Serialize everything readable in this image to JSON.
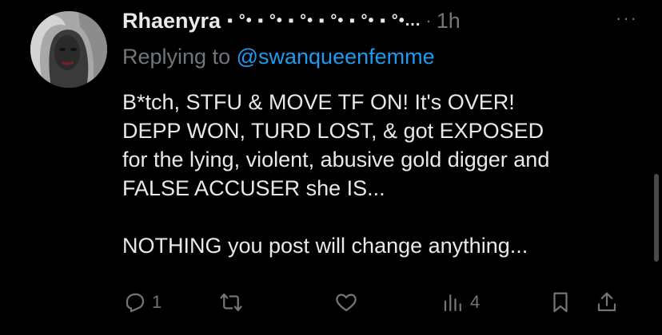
{
  "tweet": {
    "author": {
      "display_name": "Rhaenyra",
      "name_decoration": "▪ °• ▪ °• ▪ °• ▪ °• ▪ °• ▪ °•...",
      "time_separator": "·",
      "time": "1h",
      "more_label": "···",
      "avatar_icon": "profile-photo"
    },
    "replying": {
      "prefix": "Replying to ",
      "handle": "@swanqueenfemme"
    },
    "text_lines": [
      "B*tch, STFU & MOVE TF ON! It's OVER!",
      "DEPP WON, TURD LOST, & got EXPOSED",
      "for the lying, violent, abusive gold digger and",
      "FALSE ACCUSER she IS...",
      "",
      "NOTHING you post will change anything..."
    ],
    "actions": {
      "reply": {
        "icon": "reply-icon",
        "count": "1"
      },
      "retweet": {
        "icon": "retweet-icon",
        "count": ""
      },
      "like": {
        "icon": "heart-icon",
        "count": ""
      },
      "views": {
        "icon": "views-icon",
        "count": "4"
      },
      "bookmark": {
        "icon": "bookmark-icon"
      },
      "share": {
        "icon": "share-icon"
      }
    }
  },
  "colors": {
    "background": "#000000",
    "text": "#e7e9ea",
    "muted": "#71767b",
    "link": "#1d9bf0"
  }
}
